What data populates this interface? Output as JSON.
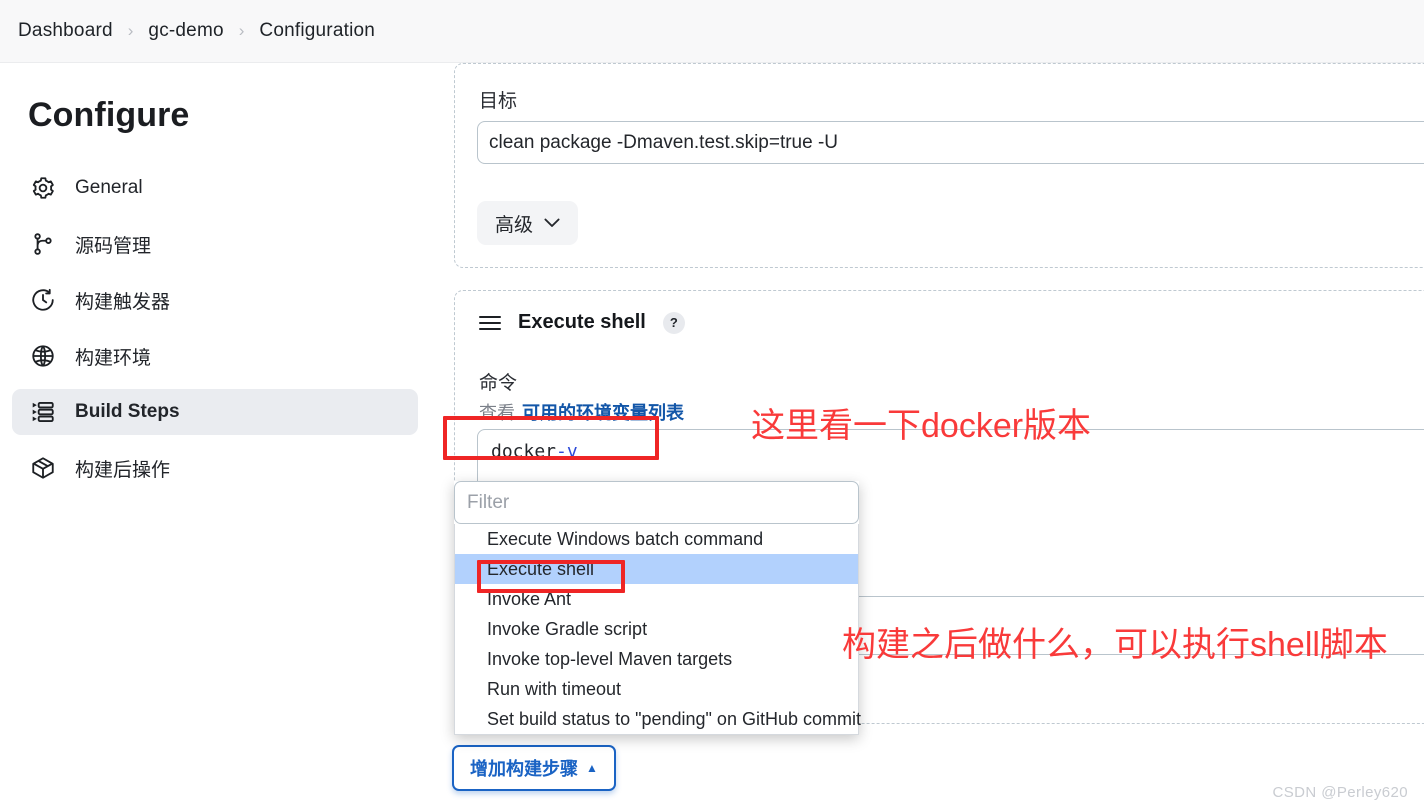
{
  "breadcrumb": {
    "items": [
      "Dashboard",
      "gc-demo",
      "Configuration"
    ],
    "separator": "›"
  },
  "sidebar": {
    "title": "Configure",
    "items": [
      {
        "label": "General",
        "icon": "gear-icon",
        "active": false
      },
      {
        "label": "源码管理",
        "icon": "branch-icon",
        "active": false
      },
      {
        "label": "构建触发器",
        "icon": "clock-icon",
        "active": false
      },
      {
        "label": "构建环境",
        "icon": "globe-icon",
        "active": false
      },
      {
        "label": "Build Steps",
        "icon": "list-icon",
        "active": true
      },
      {
        "label": "构建后操作",
        "icon": "package-icon",
        "active": false
      }
    ]
  },
  "goals_panel": {
    "label": "目标",
    "input_value": "clean package -Dmaven.test.skip=true -U",
    "advanced_button": "高级",
    "advanced_chevron": "⌄"
  },
  "shell_panel": {
    "drag_handle": "hamburger-icon",
    "title": "Execute shell",
    "help": "?",
    "command_label": "命令",
    "hint_prefix": "查看",
    "hint_link": "可用的环境变量列表",
    "command_value": "docker ",
    "command_option": "-v"
  },
  "dropdown": {
    "filter_placeholder": "Filter",
    "filter_value": "",
    "options": [
      {
        "label": "Execute Windows batch command",
        "selected": false
      },
      {
        "label": "Execute shell",
        "selected": true
      },
      {
        "label": "Invoke Ant",
        "selected": false
      },
      {
        "label": "Invoke Gradle script",
        "selected": false
      },
      {
        "label": "Invoke top-level Maven targets",
        "selected": false
      },
      {
        "label": "Run with timeout",
        "selected": false
      },
      {
        "label": "Set build status to \"pending\" on GitHub commit",
        "selected": false
      }
    ]
  },
  "add_step_button": {
    "label": "增加构建步骤",
    "caret": "▲"
  },
  "annotations": [
    {
      "id": "note-docker",
      "text": "这里看一下docker版本"
    },
    {
      "id": "note-shell",
      "text": "构建之后做什么，可以执行shell脚本"
    }
  ],
  "watermark": "CSDN @Perley620",
  "colors": {
    "accent_blue": "#1a63c4",
    "link_blue": "#1256a8",
    "selection_blue": "#b2d1fd",
    "annotation_red": "#f93a3a",
    "sidebar_active_bg": "#eaecf0",
    "panel_border": "#bfc9d1"
  }
}
